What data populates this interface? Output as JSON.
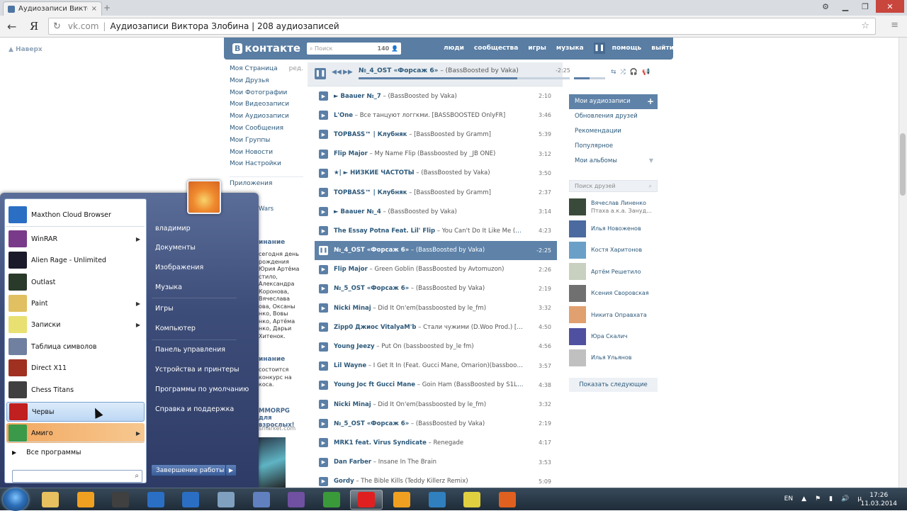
{
  "browser": {
    "tab_title": "Аудиозаписи Виктора",
    "new_tab_icon": "plus-icon",
    "url_domain": "vk.com",
    "url_separator": "|",
    "page_title": "Аудиозаписи Виктора Злобина | 208 аудиозаписей",
    "yandex_logo": "Я"
  },
  "page": {
    "back_to_top": "▲ Наверх"
  },
  "vk_header": {
    "logo_b": "В",
    "logo_text": "контакте",
    "search_placeholder": "Поиск",
    "search_count": "140",
    "nav": [
      "люди",
      "сообщества",
      "игры",
      "музыка",
      "помощь",
      "выйти"
    ]
  },
  "left_menu": {
    "items": [
      "Моя Страница",
      "Мои Друзья",
      "Мои Фотографии",
      "Мои Видеозаписи",
      "Мои Аудиозаписи",
      "Мои Сообщения",
      "Мои Группы",
      "Мои Новости",
      "Мои Настройки"
    ],
    "edit_label": "ред.",
    "apps_label": "Приложения"
  },
  "player": {
    "artist": "№_4_OST «Форсаж 6»",
    "title": "– (BassBoosted by Vaka)",
    "time": "-2:25",
    "progress": 0.75,
    "volume": 0.5
  },
  "tracks": [
    {
      "artist": "► Baauer №_7",
      "title": " – (BassBoosted by Vaka)",
      "duration": "2:10"
    },
    {
      "artist": "L'One",
      "title": " – Все танцуют логгкми. [BASSBOOSTED OnlyFR]",
      "duration": "3:46"
    },
    {
      "artist": "TOPBASS™ | Клубняк",
      "title": " – [BassBoosted by Gramm]",
      "duration": "5:39"
    },
    {
      "artist": "Flip Major",
      "title": " – My Name Flip (Bassboosted by _JB ONE)",
      "duration": "3:12"
    },
    {
      "artist": "★| ► НИЗКИЕ ЧАСТОТЫ",
      "title": " – (BassBoosted by Vaka)",
      "duration": "3:50"
    },
    {
      "artist": "TOPBASS™ | Клубняк",
      "title": " – [BassBoosted by Gramm]",
      "duration": "2:37"
    },
    {
      "artist": "► Baauer №_4",
      "title": " – (BassBoosted by Vaka)",
      "duration": "3:14"
    },
    {
      "artist": "The Essay Potna Feat. Lil' Flip",
      "title": " – You Can't Do It Like Me (Bass...",
      "duration": "4:23"
    },
    {
      "artist": "№_4_OST «Форсаж 6»",
      "title": " – (BassBoosted by Vaka)",
      "duration": "-2:25",
      "current": true
    },
    {
      "artist": "Flip Major",
      "title": " – Green Goblin (BassBoosted by Avtomuzon)",
      "duration": "2:26"
    },
    {
      "artist": "№_5_OST «Форсаж 6»",
      "title": " – (BassBoosted by Vaka)",
      "duration": "2:19"
    },
    {
      "artist": "Nicki Minaj",
      "title": " – Did It On'em(bassboosted by le_fm)",
      "duration": "3:32"
    },
    {
      "artist": "Zipp0 Джиос VitalyaM'b",
      "title": " – Стали чужими (D.Woo Prod.) [Bas...",
      "duration": "4:50"
    },
    {
      "artist": "Young Jeezy",
      "title": " – Put On (bassboosted by_le fm)",
      "duration": "4:56"
    },
    {
      "artist": "Lil Wayne",
      "title": " – I Get It In (Feat. Gucci Mane, Omarion)(bassboosted...",
      "duration": "3:57"
    },
    {
      "artist": "Young Joc ft Gucci Mane",
      "title": " – Goin Ham (BassBoosted by S1LAT)",
      "duration": "4:38"
    },
    {
      "artist": "Nicki Minaj",
      "title": " – Did It On'em(bassboosted by le_fm)",
      "duration": "3:32"
    },
    {
      "artist": "№_5_OST «Форсаж 6»",
      "title": " – (BassBoosted by Vaka)",
      "duration": "2:19"
    },
    {
      "artist": "MRK1 feat. Virus Syndicate",
      "title": " – Renegade",
      "duration": "4:17"
    },
    {
      "artist": "Dan Farber",
      "title": " – Insane In The Brain",
      "duration": "3:53"
    },
    {
      "artist": "Gordy",
      "title": " – The Bible Kills (Teddy Killerz Remix)",
      "duration": "5:09"
    }
  ],
  "right_menu": {
    "items": [
      "Мои аудиозаписи",
      "Обновления друзей",
      "Рекомендации",
      "Популярное",
      "Мои альбомы"
    ],
    "friend_search": "Поиск друзей",
    "show_more": "Показать следующие"
  },
  "friends": [
    {
      "name": "Вячеслав Линенко",
      "sub": "Птаха а.к.а. Зануд...",
      "color": "#3a4a3a"
    },
    {
      "name": "Илья Новоженов",
      "sub": "",
      "color": "#4a6aa0"
    },
    {
      "name": "Костя Харитонов",
      "sub": "",
      "color": "#6aa0c8"
    },
    {
      "name": "Артём Решетило",
      "sub": "",
      "color": "#c8d0c0"
    },
    {
      "name": "Ксения Своровская",
      "sub": "",
      "color": "#707070"
    },
    {
      "name": "Никита Оправхата",
      "sub": "",
      "color": "#e0a070"
    },
    {
      "name": "Юра Скалич",
      "sub": "",
      "color": "#5050a0"
    },
    {
      "name": "Илья Ульянов",
      "sub": "",
      "color": "#c0c0c0"
    }
  ],
  "hidden_left": {
    "wars": "Wars",
    "h1": "инание",
    "text1": "сегодня день рождения Юрия Артёма стило, Александра Коронова, Вячеслава ова, Оксаны нко, Вовы нко, Артёма нко, Дарьи Хитенок.",
    "h2": "инание",
    "text2": "состоится конкурс на коса.",
    "ad_title": "ММОRPG для взрослых!",
    "ad_sub": "smarket.com"
  },
  "start_menu": {
    "left": [
      {
        "label": "Maxthon Cloud Browser",
        "icon": "maxthon-icon",
        "color": "#2a6fc4"
      },
      {
        "label": "WinRAR",
        "icon": "winrar-icon",
        "color": "#7a3a8a",
        "arrow": true
      },
      {
        "label": "Alien Rage - Unlimited",
        "icon": "alien-rage-icon",
        "color": "#1a1a2a"
      },
      {
        "label": "Outlast",
        "icon": "outlast-icon",
        "color": "#2a3a2a"
      },
      {
        "label": "Paint",
        "icon": "paint-icon",
        "color": "#e0c060",
        "arrow": true
      },
      {
        "label": "Записки",
        "icon": "sticky-notes-icon",
        "color": "#e8e070",
        "arrow": true
      },
      {
        "label": "Таблица символов",
        "icon": "charmap-icon",
        "color": "#7080a0"
      },
      {
        "label": "Direct X11",
        "icon": "directx-icon",
        "color": "#a03020"
      },
      {
        "label": "Chess Titans",
        "icon": "chess-icon",
        "color": "#404040"
      },
      {
        "label": "Червы",
        "icon": "hearts-icon",
        "color": "#c02020",
        "hover": true
      },
      {
        "label": "Амиго",
        "icon": "amigo-icon",
        "color": "#3a9a4a",
        "arrow": true,
        "amigo": true
      }
    ],
    "all_programs": "Все программы",
    "right": [
      "владимир",
      "Документы",
      "Изображения",
      "Музыка",
      "Игры",
      "Компьютер",
      "Панель управления",
      "Устройства и принтеры",
      "Программы по умолчанию",
      "Справка и поддержка"
    ],
    "shutdown": "Завершение работы"
  },
  "taskbar": {
    "items": [
      {
        "icon": "explorer-icon",
        "color": "#e8c060"
      },
      {
        "icon": "avast-icon",
        "color": "#f0a020"
      },
      {
        "icon": "media-center-icon",
        "color": "#404040"
      },
      {
        "icon": "d-app-icon",
        "color": "#2a6fc4"
      },
      {
        "icon": "maxthon-taskbar-icon",
        "color": "#2a6fc4"
      },
      {
        "icon": "tools-icon",
        "color": "#80a0c0"
      },
      {
        "icon": "speaker-app-icon",
        "color": "#6080c0"
      },
      {
        "icon": "visual-studio-icon",
        "color": "#7050a0"
      },
      {
        "icon": "utorrent-icon",
        "color": "#3a9a3a"
      },
      {
        "icon": "yandex-browser-icon",
        "color": "#e02020",
        "active": true
      },
      {
        "icon": "amigo-taskbar-icon",
        "color": "#f0a020"
      },
      {
        "icon": "globe-icon",
        "color": "#3080c0"
      },
      {
        "icon": "bulb-icon",
        "color": "#e0d040"
      },
      {
        "icon": "office-icon",
        "color": "#e06020"
      }
    ],
    "lang": "EN",
    "time": "17:26",
    "date": "11.03.2014"
  }
}
